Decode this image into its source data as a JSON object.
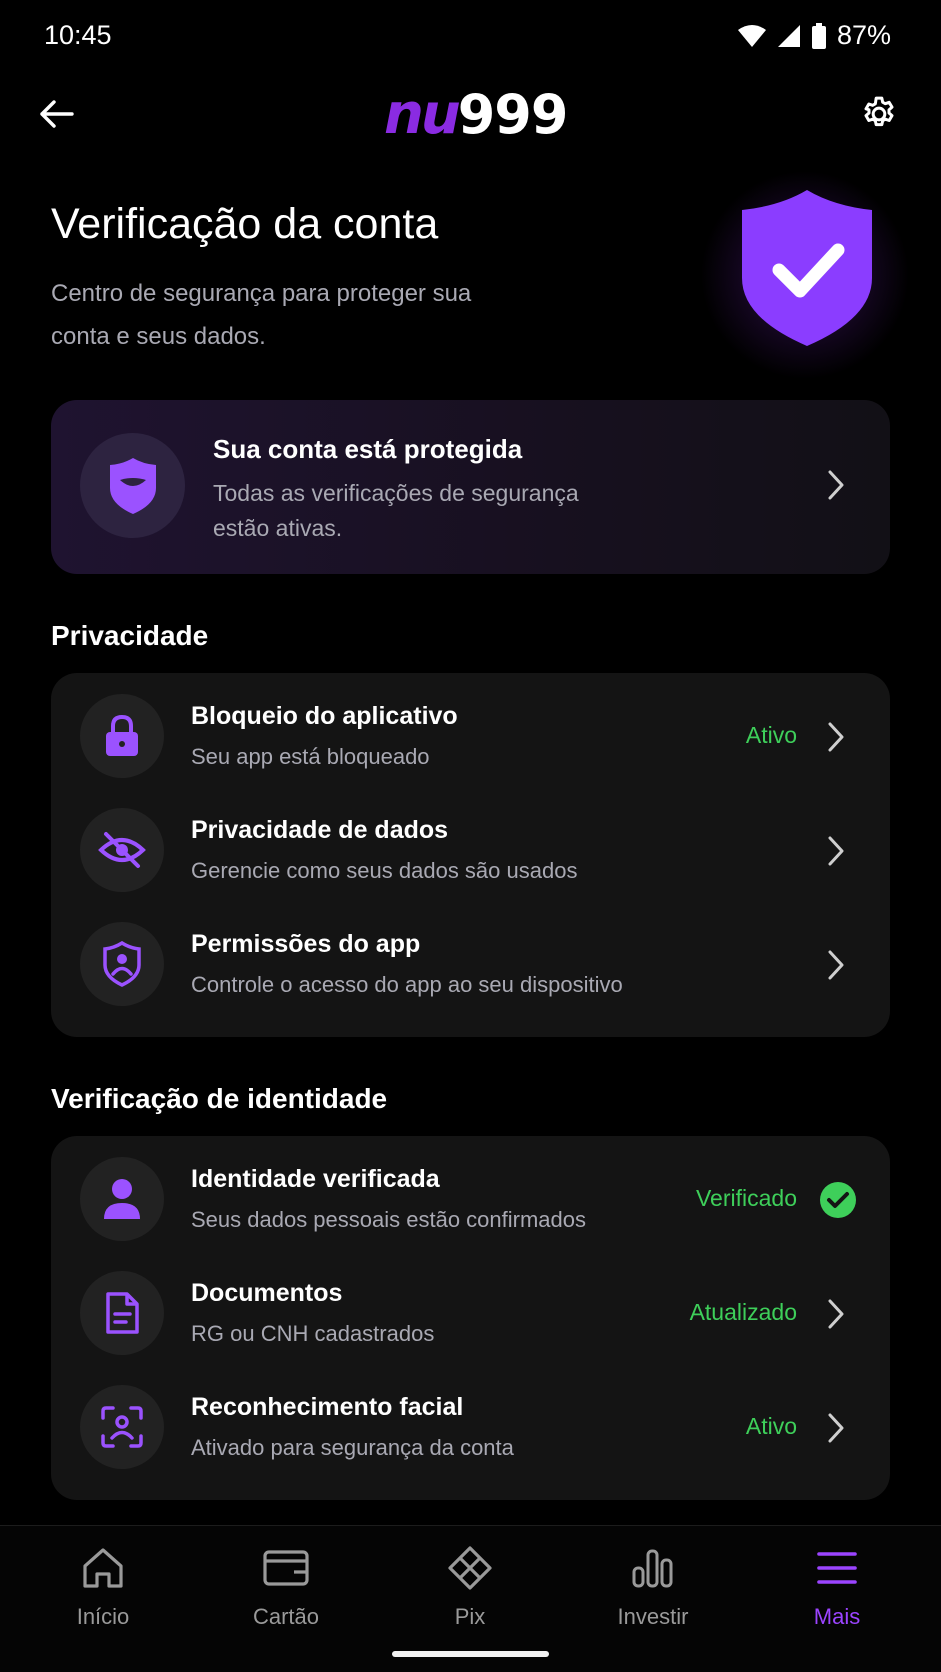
{
  "status_bar": {
    "time": "10:45",
    "battery": "87%"
  },
  "top_bar": {
    "logo_brand": "nu",
    "logo_number": "999"
  },
  "hero": {
    "title": "Verificação da conta",
    "subtitle": "Centro de segurança para proteger sua conta e seus dados."
  },
  "protect_card": {
    "title": "Sua conta está protegida",
    "description": "Todas as verificações de segurança estão ativas."
  },
  "privacy": {
    "section_title": "Privacidade",
    "items": [
      {
        "title": "Bloqueio do aplicativo",
        "subtitle": "Seu app está bloqueado",
        "status": "Ativo",
        "icon": "lock-icon"
      },
      {
        "title": "Privacidade de dados",
        "subtitle": "Gerencie como seus dados são usados",
        "status": "",
        "icon": "eye-off-icon"
      },
      {
        "title": "Permissões do app",
        "subtitle": "Controle o acesso do app ao seu dispositivo",
        "status": "",
        "icon": "user-shield-icon"
      }
    ]
  },
  "identity": {
    "section_title": "Verificação de identidade",
    "items": [
      {
        "title": "Identidade verificada",
        "subtitle": "Seus dados pessoais estão confirmados",
        "status": "Verificado",
        "icon": "person-icon"
      },
      {
        "title": "Documentos",
        "subtitle": "RG ou CNH cadastrados",
        "status": "Atualizado",
        "icon": "document-icon"
      },
      {
        "title": "Reconhecimento facial",
        "subtitle": "Ativado para segurança da conta",
        "status": "Ativo",
        "icon": "face-scan-icon"
      }
    ]
  },
  "bottom_nav": {
    "items": [
      {
        "label": "Início",
        "icon": "home-icon"
      },
      {
        "label": "Cartão",
        "icon": "card-icon"
      },
      {
        "label": "Pix",
        "icon": "pix-icon"
      },
      {
        "label": "Investir",
        "icon": "chart-icon"
      },
      {
        "label": "Mais",
        "icon": "menu-icon"
      }
    ],
    "active": "Mais"
  },
  "colors": {
    "accent": "#8a2be2",
    "success": "#3ecf5a",
    "background": "#000000",
    "card": "#141414"
  }
}
